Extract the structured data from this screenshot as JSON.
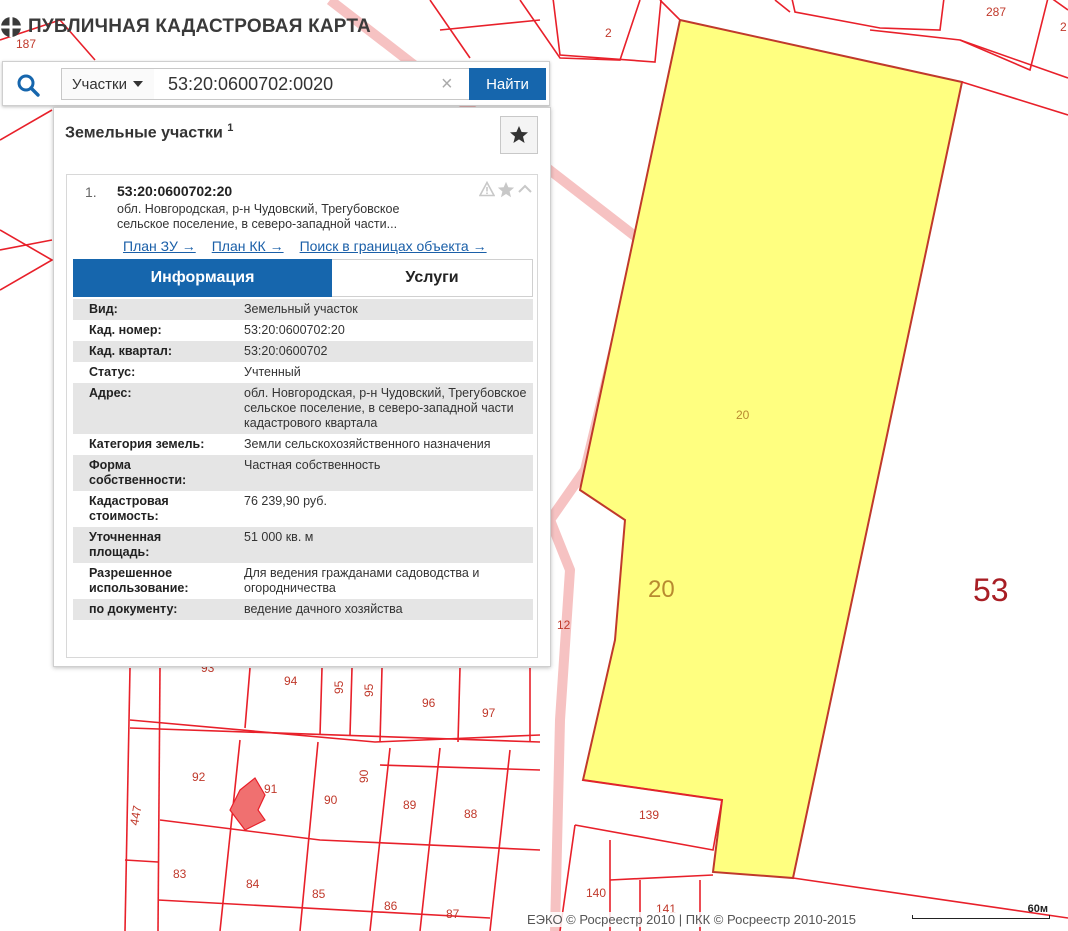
{
  "app": {
    "title": "ПУБЛИЧНАЯ КАДАСТРОВАЯ КАРТА"
  },
  "search": {
    "type_label": "Участки",
    "value": "53:20:0600702:0020",
    "find_label": "Найти",
    "clear_glyph": "×"
  },
  "panel": {
    "title": "Земельные участки",
    "count": "1",
    "result": {
      "number": "1.",
      "cad_number": "53:20:0600702:20",
      "address": "обл. Новгородская, р-н Чудовский, Трегубовское сельское поселение, в северо-западной части...",
      "links": [
        "План ЗУ →",
        "План КК →",
        "Поиск в границах объекта →"
      ],
      "tabs": {
        "info": "Информация",
        "services": "Услуги"
      },
      "info": [
        {
          "key": "Вид:",
          "value": "Земельный участок"
        },
        {
          "key": "Кад. номер:",
          "value": "53:20:0600702:20",
          "link": true
        },
        {
          "key": "Кад. квартал:",
          "value": "53:20:0600702",
          "link": true
        },
        {
          "key": "Статус:",
          "value": "Учтенный"
        },
        {
          "key": "Адрес:",
          "value": "обл. Новгородская, р-н Чудовский, Трегубовское сельское поселение, в северо-западной части кадастрового квартала"
        },
        {
          "key": "Категория земель:",
          "value": "Земли сельскохозяйственного назначения"
        },
        {
          "key": "Форма собственности:",
          "value": "Частная собственность"
        },
        {
          "key": "Кадастровая стоимость:",
          "value": "76 239,90 руб."
        },
        {
          "key": "Уточненная площадь:",
          "value": "51 000 кв. м"
        },
        {
          "key": "Разрешенное использование:",
          "value": "Для ведения гражданами садоводства и огородничества"
        },
        {
          "key": "по документу:",
          "value": "ведение дачного хозяйства"
        }
      ]
    }
  },
  "map": {
    "colors": {
      "parcel_line": "#e8202a",
      "highlight_fill": "#ffff80",
      "highlight_stroke": "#c0392b",
      "road": "#f6c2c2",
      "building": "#f07070",
      "label": "#c0392b"
    },
    "labels": {
      "l187": "187",
      "l2": "2",
      "l287": "287",
      "l2b": "2",
      "l20small": "20",
      "l20big": "20",
      "l53": "53",
      "l12": "12",
      "l93": "93",
      "l94": "94",
      "l95a": "95",
      "l95b": "95",
      "l96": "96",
      "l97": "97",
      "l92": "92",
      "l91": "91",
      "l90a": "90",
      "l90b": "90",
      "l89": "89",
      "l88": "88",
      "l447": "447",
      "l83": "83",
      "l84": "84",
      "l85": "85",
      "l86": "86",
      "l87": "87",
      "l139": "139",
      "l140": "140",
      "l141": "141"
    }
  },
  "footer": {
    "attribution": "ЕЭКО © Росреестр 2010 | ПКК © Росреестр 2010-2015",
    "scale_label": "60м"
  }
}
